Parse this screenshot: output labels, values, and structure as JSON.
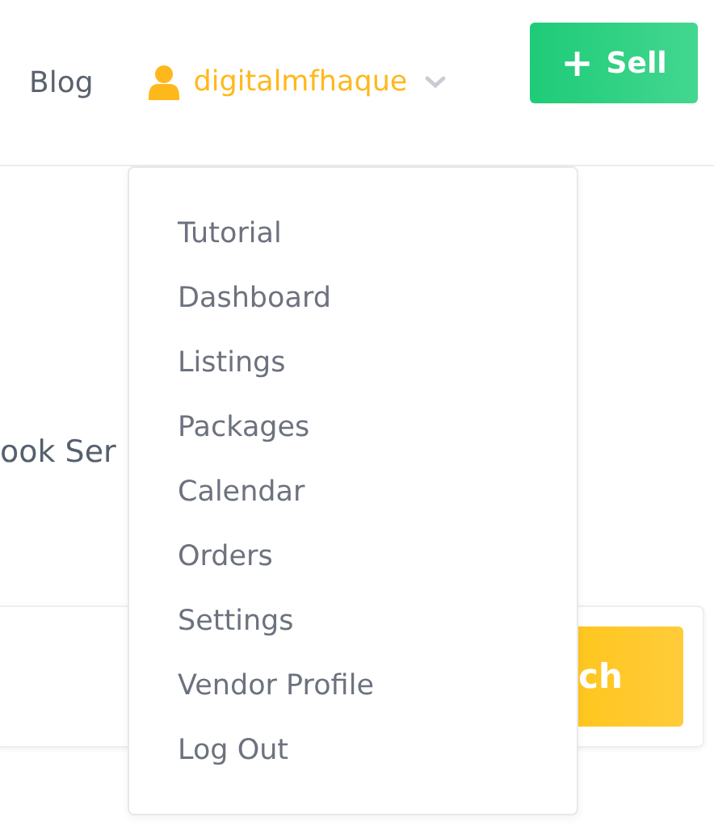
{
  "header": {
    "blog_link": "Blog",
    "user_menu": {
      "name": "digitalmfhaque",
      "expanded": true
    },
    "sell_button": {
      "icon": "+",
      "label": "Sell"
    }
  },
  "user_dropdown": [
    "Tutorial",
    "Dashboard",
    "Listings",
    "Packages",
    "Calendar",
    "Orders",
    "Settings",
    "Vendor Profile",
    "Log Out"
  ],
  "content": {
    "heading": "ook Ser",
    "search_button": "ch"
  }
}
